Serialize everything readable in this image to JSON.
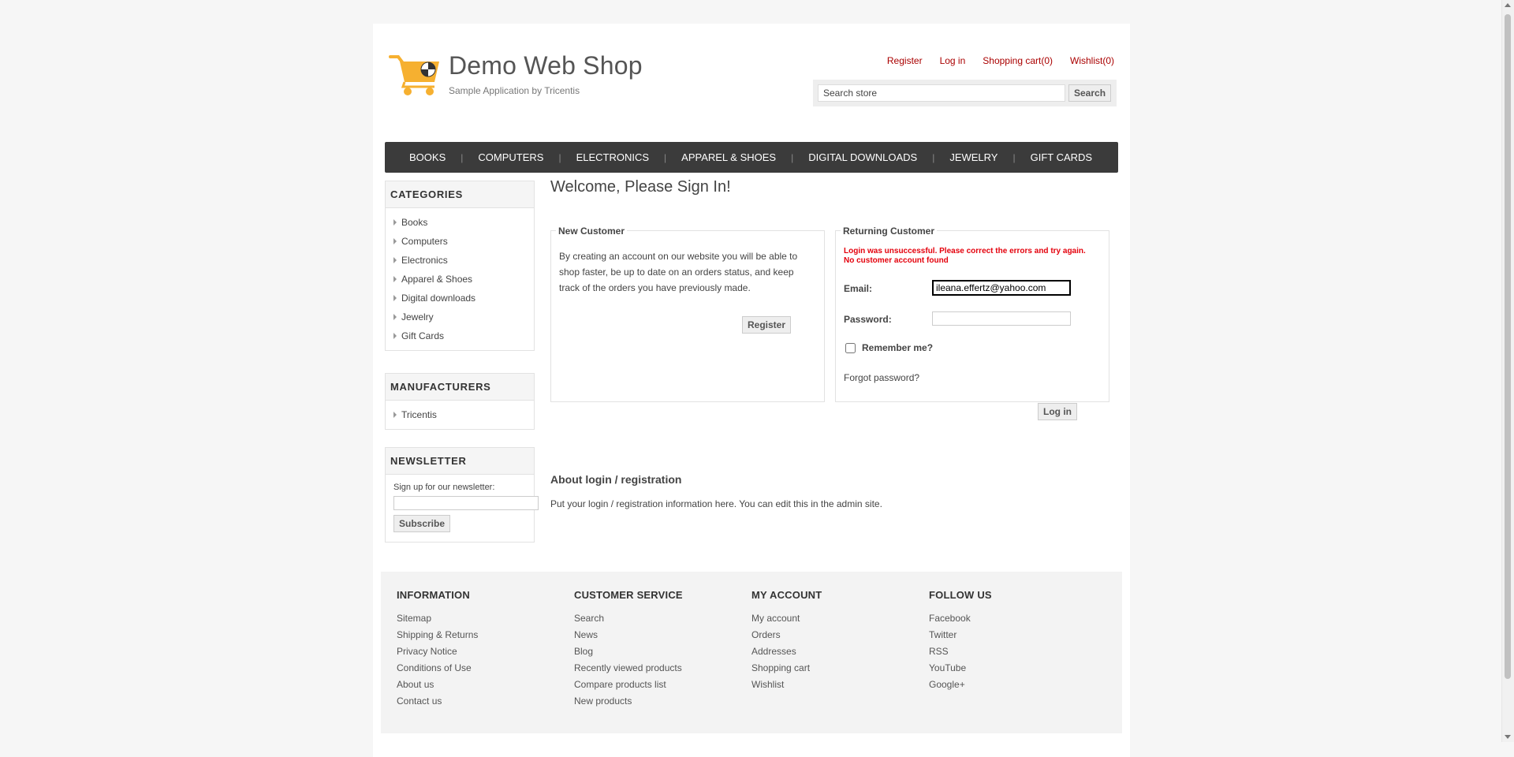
{
  "header": {
    "logo_title": "Demo Web Shop",
    "logo_subtitle": "Sample Application by Tricentis",
    "links": [
      "Register",
      "Log in",
      "Shopping cart(0)",
      "Wishlist(0)"
    ],
    "search_value": "Search store",
    "search_button": "Search"
  },
  "topmenu": [
    "BOOKS",
    "COMPUTERS",
    "ELECTRONICS",
    "APPAREL & SHOES",
    "DIGITAL DOWNLOADS",
    "JEWELRY",
    "GIFT CARDS"
  ],
  "sidebar": {
    "categories_title": "CATEGORIES",
    "categories": [
      "Books",
      "Computers",
      "Electronics",
      "Apparel & Shoes",
      "Digital downloads",
      "Jewelry",
      "Gift Cards"
    ],
    "manufacturers_title": "MANUFACTURERS",
    "manufacturers": [
      "Tricentis"
    ],
    "newsletter_title": "NEWSLETTER",
    "newsletter_label": "Sign up for our newsletter:",
    "subscribe_button": "Subscribe"
  },
  "main": {
    "title": "Welcome, Please Sign In!",
    "new_customer": {
      "legend": "New Customer",
      "text": "By creating an account on our website you will be able to shop faster, be up to date on an orders status, and keep track of the orders you have previously made.",
      "register_button": "Register"
    },
    "returning": {
      "legend": "Returning Customer",
      "error_line1": "Login was unsuccessful. Please correct the errors and try again.",
      "error_line2": "No customer account found",
      "email_label": "Email:",
      "email_value": "ileana.effertz@yahoo.com",
      "password_label": "Password:",
      "remember_label": "Remember me?",
      "forgot": "Forgot password?",
      "login_button": "Log in"
    },
    "about_title": "About login / registration",
    "about_text": "Put your login / registration information here. You can edit this in the admin site."
  },
  "footer": {
    "information": {
      "title": "INFORMATION",
      "links": [
        "Sitemap",
        "Shipping & Returns",
        "Privacy Notice",
        "Conditions of Use",
        "About us",
        "Contact us"
      ]
    },
    "customer_service": {
      "title": "CUSTOMER SERVICE",
      "links": [
        "Search",
        "News",
        "Blog",
        "Recently viewed products",
        "Compare products list",
        "New products"
      ]
    },
    "my_account": {
      "title": "MY ACCOUNT",
      "links": [
        "My account",
        "Orders",
        "Addresses",
        "Shopping cart",
        "Wishlist"
      ]
    },
    "follow_us": {
      "title": "FOLLOW US",
      "links": [
        "Facebook",
        "Twitter",
        "RSS",
        "YouTube",
        "Google+"
      ]
    }
  },
  "colors": {
    "link_red": "#aa0000",
    "menu_bg": "#3b3b3b",
    "error_red": "#e4000c",
    "cart_orange": "#f6b030"
  },
  "icons": {
    "logo": "shopping-cart-icon"
  }
}
